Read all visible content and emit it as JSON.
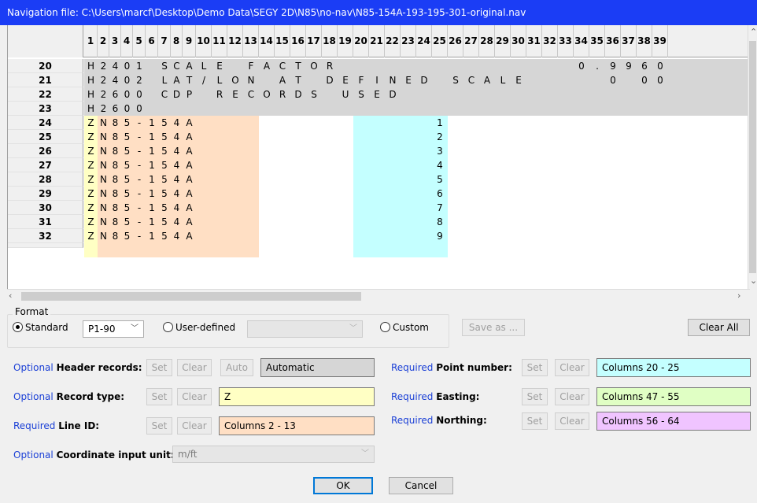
{
  "window": {
    "title": "Navigation file: C:\\Users\\marcf\\Desktop\\Demo Data\\SEGY 2D\\N85\\no-nav\\N85-154A-193-195-301-original.nav"
  },
  "grid": {
    "column_headers": [
      "1",
      "2",
      "3",
      "4",
      "5",
      "6",
      "7",
      "8",
      "9",
      "10",
      "11",
      "12",
      "13",
      "14",
      "15",
      "16",
      "17",
      "18",
      "19",
      "20",
      "21",
      "22",
      "23",
      "24",
      "25",
      "26",
      "27",
      "28",
      "29",
      "30",
      "31",
      "32",
      "33",
      "34",
      "35",
      "36",
      "37",
      "38",
      "39"
    ],
    "rows": [
      {
        "num": "20",
        "cells": [
          "H",
          "2",
          "4",
          "0",
          "1",
          "",
          "S",
          "C",
          "A",
          "L",
          "E",
          "",
          "F",
          "A",
          "C",
          "T",
          "O",
          "R",
          "",
          "",
          "",
          "",
          "",
          "",
          "",
          "",
          "",
          "",
          "",
          "",
          "",
          "",
          "",
          "0",
          ".",
          "9",
          "9",
          "6",
          "0"
        ]
      },
      {
        "num": "21",
        "cells": [
          "H",
          "2",
          "4",
          "0",
          "2",
          "",
          "L",
          "A",
          "T",
          "/",
          "L",
          "O",
          "N",
          "",
          "A",
          "T",
          "",
          "D",
          "E",
          "F",
          "I",
          "N",
          "E",
          "D",
          "",
          "S",
          "C",
          "A",
          "L",
          "E",
          "",
          "",
          "",
          "",
          "",
          "0",
          "",
          "0",
          "0"
        ]
      },
      {
        "num": "22",
        "cells": [
          "H",
          "2",
          "6",
          "0",
          "0",
          "",
          "C",
          "D",
          "P",
          "",
          "R",
          "E",
          "C",
          "O",
          "R",
          "D",
          "S",
          "",
          "U",
          "S",
          "E",
          "D",
          "",
          "",
          "",
          "",
          "",
          "",
          "",
          "",
          "",
          "",
          "",
          "",
          "",
          "",
          "",
          "",
          ""
        ]
      },
      {
        "num": "23",
        "cells": [
          "H",
          "2",
          "6",
          "0",
          "0",
          "",
          "",
          "",
          "",
          "",
          "",
          "",
          "",
          "",
          "",
          "",
          "",
          "",
          "",
          "",
          "",
          "",
          "",
          "",
          "",
          "",
          "",
          "",
          "",
          "",
          "",
          "",
          "",
          "",
          "",
          "",
          "",
          "",
          ""
        ]
      },
      {
        "num": "24",
        "cells": [
          "Z",
          "N",
          "8",
          "5",
          "-",
          "1",
          "5",
          "4",
          "A",
          "",
          "",
          "",
          "",
          "",
          "",
          "",
          "",
          "",
          "",
          "",
          "",
          "",
          "",
          "",
          "1",
          "",
          "",
          "",
          "",
          "",
          "",
          "",
          "",
          "",
          "",
          "",
          "",
          "",
          ""
        ]
      },
      {
        "num": "25",
        "cells": [
          "Z",
          "N",
          "8",
          "5",
          "-",
          "1",
          "5",
          "4",
          "A",
          "",
          "",
          "",
          "",
          "",
          "",
          "",
          "",
          "",
          "",
          "",
          "",
          "",
          "",
          "",
          "2",
          "",
          "",
          "",
          "",
          "",
          "",
          "",
          "",
          "",
          "",
          "",
          "",
          "",
          ""
        ]
      },
      {
        "num": "26",
        "cells": [
          "Z",
          "N",
          "8",
          "5",
          "-",
          "1",
          "5",
          "4",
          "A",
          "",
          "",
          "",
          "",
          "",
          "",
          "",
          "",
          "",
          "",
          "",
          "",
          "",
          "",
          "",
          "3",
          "",
          "",
          "",
          "",
          "",
          "",
          "",
          "",
          "",
          "",
          "",
          "",
          "",
          ""
        ]
      },
      {
        "num": "27",
        "cells": [
          "Z",
          "N",
          "8",
          "5",
          "-",
          "1",
          "5",
          "4",
          "A",
          "",
          "",
          "",
          "",
          "",
          "",
          "",
          "",
          "",
          "",
          "",
          "",
          "",
          "",
          "",
          "4",
          "",
          "",
          "",
          "",
          "",
          "",
          "",
          "",
          "",
          "",
          "",
          "",
          "",
          ""
        ]
      },
      {
        "num": "28",
        "cells": [
          "Z",
          "N",
          "8",
          "5",
          "-",
          "1",
          "5",
          "4",
          "A",
          "",
          "",
          "",
          "",
          "",
          "",
          "",
          "",
          "",
          "",
          "",
          "",
          "",
          "",
          "",
          "5",
          "",
          "",
          "",
          "",
          "",
          "",
          "",
          "",
          "",
          "",
          "",
          "",
          "",
          ""
        ]
      },
      {
        "num": "29",
        "cells": [
          "Z",
          "N",
          "8",
          "5",
          "-",
          "1",
          "5",
          "4",
          "A",
          "",
          "",
          "",
          "",
          "",
          "",
          "",
          "",
          "",
          "",
          "",
          "",
          "",
          "",
          "",
          "6",
          "",
          "",
          "",
          "",
          "",
          "",
          "",
          "",
          "",
          "",
          "",
          "",
          "",
          ""
        ]
      },
      {
        "num": "30",
        "cells": [
          "Z",
          "N",
          "8",
          "5",
          "-",
          "1",
          "5",
          "4",
          "A",
          "",
          "",
          "",
          "",
          "",
          "",
          "",
          "",
          "",
          "",
          "",
          "",
          "",
          "",
          "",
          "7",
          "",
          "",
          "",
          "",
          "",
          "",
          "",
          "",
          "",
          "",
          "",
          "",
          "",
          ""
        ]
      },
      {
        "num": "31",
        "cells": [
          "Z",
          "N",
          "8",
          "5",
          "-",
          "1",
          "5",
          "4",
          "A",
          "",
          "",
          "",
          "",
          "",
          "",
          "",
          "",
          "",
          "",
          "",
          "",
          "",
          "",
          "",
          "8",
          "",
          "",
          "",
          "",
          "",
          "",
          "",
          "",
          "",
          "",
          "",
          "",
          "",
          ""
        ]
      },
      {
        "num": "32",
        "cells": [
          "Z",
          "N",
          "8",
          "5",
          "-",
          "1",
          "5",
          "4",
          "A",
          "",
          "",
          "",
          "",
          "",
          "",
          "",
          "",
          "",
          "",
          "",
          "",
          "",
          "",
          "",
          "9",
          "",
          "",
          "",
          "",
          "",
          "",
          "",
          "",
          "",
          "",
          "",
          "",
          "",
          ""
        ]
      }
    ]
  },
  "format": {
    "group_label": "Format",
    "standard_label": "Standard",
    "standard_value": "P1-90",
    "user_defined_label": "User-defined",
    "user_defined_value": "",
    "custom_label": "Custom",
    "save_as_label": "Save as ...",
    "clear_all_label": "Clear All"
  },
  "fields": {
    "optional": "Optional",
    "required": "Required",
    "header_records_label": "Header records:",
    "header_records_value": "Automatic",
    "record_type_label": "Record type:",
    "record_type_value": "Z",
    "line_id_label": "Line ID:",
    "line_id_value": "Columns  2 - 13",
    "coord_unit_label": "Coordinate input unit:",
    "coord_unit_value": "m/ft",
    "point_number_label": "Point number:",
    "point_number_value": "Columns 20 - 25",
    "easting_label": "Easting:",
    "easting_value": "Columns 47 - 55",
    "northing_label": "Northing:",
    "northing_value": "Columns 56 - 64",
    "set_label": "Set",
    "clear_label": "Clear",
    "auto_label": "Auto"
  },
  "buttons": {
    "ok": "OK",
    "cancel": "Cancel"
  },
  "colors": {
    "title_bar": "#1b3df5",
    "header_gray": "#d6d6d6",
    "record_type_yellow": "#ffffc4",
    "line_id_peach": "#ffdfc4",
    "point_number_cyan": "#c4ffff",
    "easting_green": "#e0ffc4",
    "northing_pink": "#f0c4ff"
  }
}
